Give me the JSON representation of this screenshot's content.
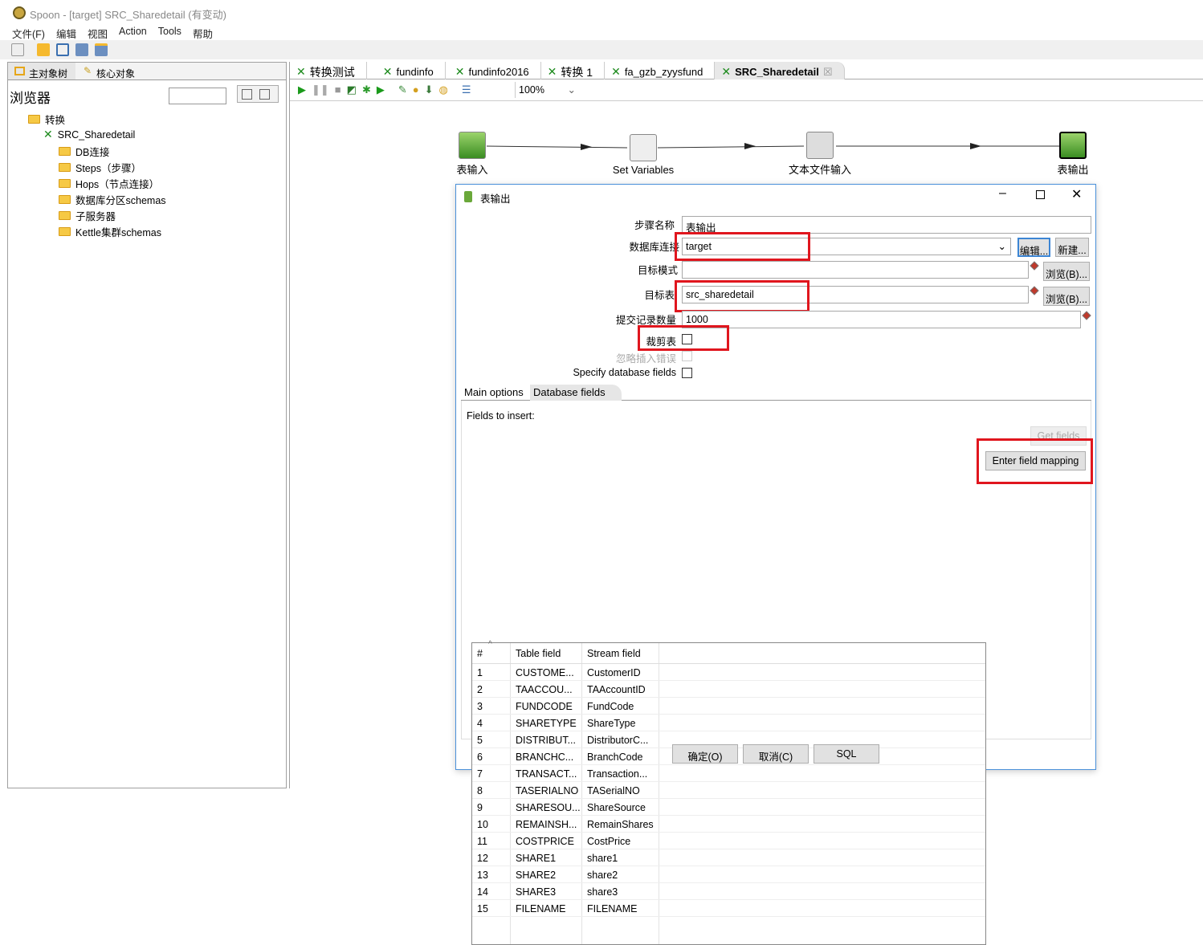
{
  "window": {
    "title": "Spoon - [target] SRC_Sharedetail (有变动)"
  },
  "menu": [
    "文件(F)",
    "编辑",
    "视图",
    "Action",
    "Tools",
    "帮助"
  ],
  "left_panel": {
    "tabs": [
      "主对象树",
      "核心对象"
    ],
    "browser_label": "浏览器",
    "search_value": "",
    "tree": [
      {
        "label": "转换",
        "type": "folder"
      },
      {
        "label": "SRC_Sharedetail",
        "type": "transformation"
      },
      {
        "label": "DB连接",
        "type": "folder"
      },
      {
        "label": "Steps（步骤）",
        "type": "folder"
      },
      {
        "label": "Hops（节点连接）",
        "type": "folder"
      },
      {
        "label": "数据库分区schemas",
        "type": "folder"
      },
      {
        "label": "子服务器",
        "type": "folder"
      },
      {
        "label": "Kettle集群schemas",
        "type": "folder"
      }
    ]
  },
  "file_tabs": [
    {
      "label": "转换测试"
    },
    {
      "label": "fundinfo"
    },
    {
      "label": "fundinfo2016"
    },
    {
      "label": "转换 1"
    },
    {
      "label": "fa_gzb_zyysfund"
    },
    {
      "label": "SRC_Sharedetail",
      "active": true
    }
  ],
  "zoom": "100%",
  "canvas": {
    "steps": [
      "表输入",
      "Set Variables",
      "文本文件输入",
      "表输出"
    ]
  },
  "dialog": {
    "title": "表输出",
    "step_name_label": "步骤名称",
    "step_name": "表输出",
    "connection_label": "数据库连接",
    "connection": "target",
    "edit_btn": "编辑...",
    "new_btn": "新建...",
    "schema_label": "目标模式",
    "schema": "",
    "browse_btn": "浏览(B)...",
    "table_label": "目标表",
    "table": "src_sharedetail",
    "commit_label": "提交记录数量",
    "commit": "1000",
    "truncate_label": "裁剪表",
    "truncate": false,
    "ignore_label": "忽略插入错误",
    "ignore": false,
    "specify_label": "Specify database fields",
    "specify": false,
    "tabs": [
      "Main options",
      "Database fields"
    ],
    "fields_label": "Fields to insert:",
    "columns": [
      "#",
      "Table field",
      "Stream field"
    ],
    "rows": [
      [
        "1",
        "CUSTOME...",
        "CustomerID"
      ],
      [
        "2",
        "TAACCOU...",
        "TAAccountID"
      ],
      [
        "3",
        "FUNDCODE",
        "FundCode"
      ],
      [
        "4",
        "SHARETYPE",
        "ShareType"
      ],
      [
        "5",
        "DISTRIBUT...",
        "DistributorC..."
      ],
      [
        "6",
        "BRANCHC...",
        "BranchCode"
      ],
      [
        "7",
        "TRANSACT...",
        "Transaction..."
      ],
      [
        "8",
        "TASERIALNO",
        "TASerialNO"
      ],
      [
        "9",
        "SHARESOU...",
        "ShareSource"
      ],
      [
        "10",
        "REMAINSH...",
        "RemainShares"
      ],
      [
        "11",
        "COSTPRICE",
        "CostPrice"
      ],
      [
        "12",
        "SHARE1",
        "share1"
      ],
      [
        "13",
        "SHARE2",
        "share2"
      ],
      [
        "14",
        "SHARE3",
        "share3"
      ],
      [
        "15",
        "FILENAME",
        "FILENAME"
      ]
    ],
    "get_fields_btn": "Get fields",
    "mapping_btn": "Enter field mapping",
    "ok_btn": "确定(O)",
    "cancel_btn": "取消(C)",
    "sql_btn": "SQL",
    "highlight_color": "#e0161e"
  }
}
